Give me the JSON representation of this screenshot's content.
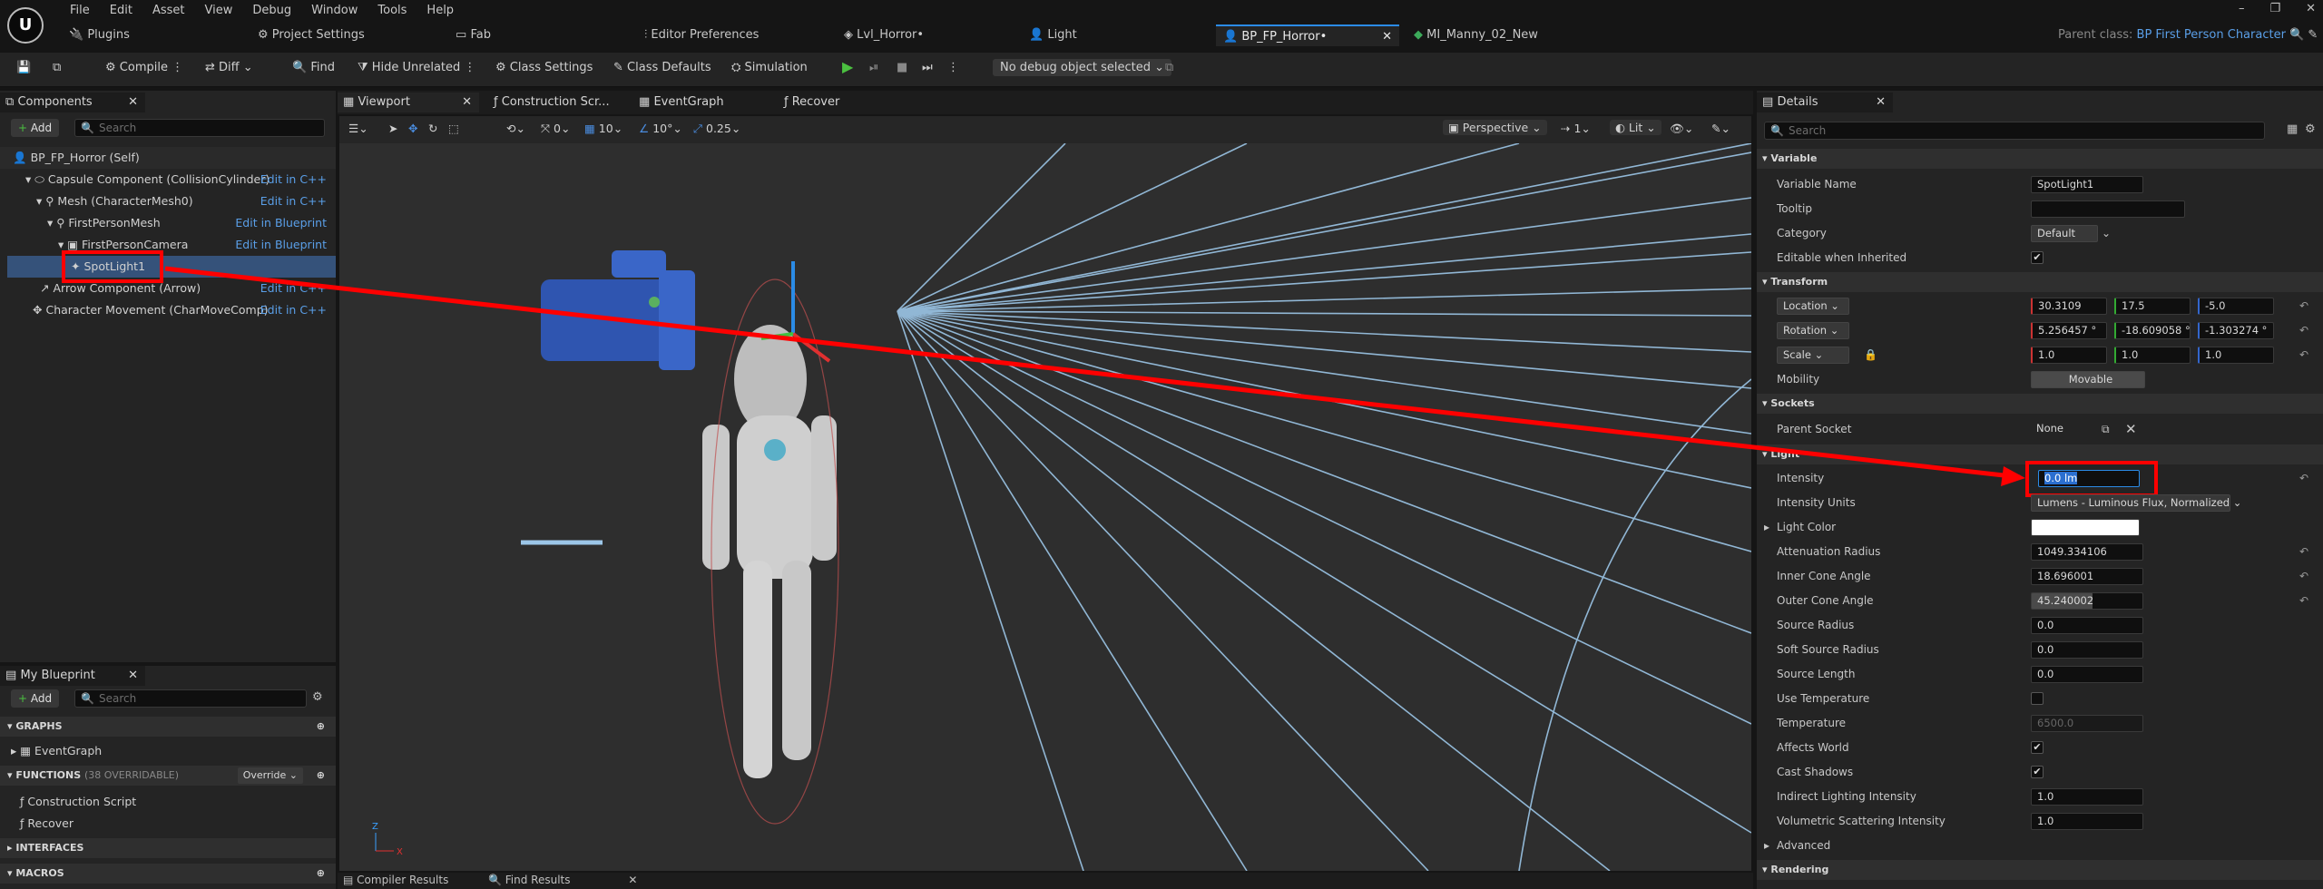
{
  "menu": [
    "File",
    "Edit",
    "Asset",
    "View",
    "Debug",
    "Window",
    "Tools",
    "Help"
  ],
  "tabs": [
    {
      "label": "Plugins",
      "icon": "plug-icon"
    },
    {
      "label": "Project Settings",
      "icon": "gear-icon"
    },
    {
      "label": "Fab",
      "icon": "folder-icon"
    },
    {
      "label": "Editor Preferences",
      "icon": "sliders-icon"
    },
    {
      "label": "Lvl_Horror•",
      "icon": "level-icon"
    },
    {
      "label": "Light",
      "icon": "person-icon"
    },
    {
      "label": "BP_FP_Horror•",
      "icon": "person-icon"
    },
    {
      "label": "MI_Manny_02_New",
      "icon": "material-icon"
    }
  ],
  "parent_class": {
    "label": "Parent class:",
    "value": "BP First Person Character"
  },
  "toolbar": {
    "compile": "Compile",
    "diff": "Diff",
    "find": "Find",
    "hide_unrelated": "Hide Unrelated",
    "class_settings": "Class Settings",
    "class_defaults": "Class Defaults",
    "simulation": "Simulation",
    "debug_object": "No debug object selected"
  },
  "components": {
    "tab": "Components",
    "add": "Add",
    "search_placeholder": "Search",
    "rows": [
      {
        "label": "BP_FP_Horror (Self)",
        "link": ""
      },
      {
        "label": "Capsule Component (CollisionCylinder)",
        "link": "Edit in C++"
      },
      {
        "label": "Mesh (CharacterMesh0)",
        "link": "Edit in C++"
      },
      {
        "label": "FirstPersonMesh",
        "link": "Edit in Blueprint"
      },
      {
        "label": "FirstPersonCamera",
        "link": "Edit in Blueprint"
      },
      {
        "label": "SpotLight1",
        "link": ""
      },
      {
        "label": "Arrow Component (Arrow)",
        "link": "Edit in C++"
      },
      {
        "label": "Character Movement (CharMoveComp)",
        "link": "Edit in C++"
      }
    ]
  },
  "my_blueprint": {
    "tab": "My Blueprint",
    "add": "Add",
    "search_placeholder": "Search",
    "graphs": "GRAPHS",
    "eventgraph": "EventGraph",
    "functions": "FUNCTIONS",
    "functions_count": "(38 OVERRIDABLE)",
    "override": "Override",
    "function_items": [
      "Construction Script",
      "Recover"
    ],
    "interfaces": "INTERFACES",
    "macros": "MACROS"
  },
  "editor_tabs": [
    "Viewport",
    "Construction Scr...",
    "EventGraph",
    "Recover"
  ],
  "viewport": {
    "perspective": "Perspective",
    "lit": "Lit",
    "snap_translate": "10",
    "snap_rotate": "10°",
    "snap_scale": "0.25",
    "cam_speed": "1",
    "grid": "0"
  },
  "bottom_tabs": [
    "Compiler Results",
    "Find Results"
  ],
  "details": {
    "tab": "Details",
    "search_placeholder": "Search",
    "sections": {
      "variable": "Variable",
      "transform": "Transform",
      "sockets": "Sockets",
      "light": "Light",
      "advanced": "Advanced",
      "rendering": "Rendering"
    },
    "variable_name": {
      "label": "Variable Name",
      "value": "SpotLight1"
    },
    "tooltip": {
      "label": "Tooltip",
      "value": ""
    },
    "category": {
      "label": "Category",
      "value": "Default"
    },
    "editable": {
      "label": "Editable when Inherited",
      "checked": true
    },
    "location": {
      "label": "Location",
      "x": "30.3109",
      "y": "17.5",
      "z": "-5.0"
    },
    "rotation": {
      "label": "Rotation",
      "x": "5.256457 °",
      "y": "-18.609058 °",
      "z": "-1.303274 °"
    },
    "scale": {
      "label": "Scale",
      "x": "1.0",
      "y": "1.0",
      "z": "1.0"
    },
    "mobility": {
      "label": "Mobility",
      "value": "Movable"
    },
    "parent_socket": {
      "label": "Parent Socket",
      "value": "None"
    },
    "intensity": {
      "label": "Intensity",
      "value": "0.0 lm"
    },
    "intensity_units": {
      "label": "Intensity Units",
      "value": "Lumens - Luminous Flux, Normalized"
    },
    "light_color": {
      "label": "Light Color",
      "value": "#ffffff"
    },
    "attenuation": {
      "label": "Attenuation Radius",
      "value": "1049.334106"
    },
    "inner_cone": {
      "label": "Inner Cone Angle",
      "value": "18.696001"
    },
    "outer_cone": {
      "label": "Outer Cone Angle",
      "value": "45.240002"
    },
    "source_radius": {
      "label": "Source Radius",
      "value": "0.0"
    },
    "soft_source": {
      "label": "Soft Source Radius",
      "value": "0.0"
    },
    "source_length": {
      "label": "Source Length",
      "value": "0.0"
    },
    "use_temp": {
      "label": "Use Temperature",
      "checked": false
    },
    "temperature": {
      "label": "Temperature",
      "value": "6500.0"
    },
    "affects_world": {
      "label": "Affects World",
      "checked": true
    },
    "cast_shadows": {
      "label": "Cast Shadows",
      "checked": true
    },
    "indirect": {
      "label": "Indirect Lighting Intensity",
      "value": "1.0"
    },
    "volumetric": {
      "label": "Volumetric Scattering Intensity",
      "value": "1.0"
    }
  },
  "colors": {
    "accent": "#2b8be6",
    "highlight": "#ff0000",
    "link": "#5a9fe8",
    "panel": "#242424"
  }
}
